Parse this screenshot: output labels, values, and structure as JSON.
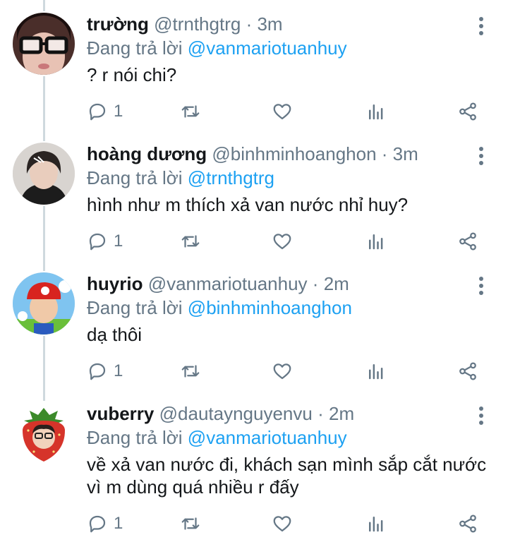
{
  "colors": {
    "accent": "#1da1f2",
    "muted": "#657786",
    "thread_line": "#cfd9de"
  },
  "tweets": [
    {
      "name": "trường",
      "handle": "@trnthgtrg",
      "time": "3m",
      "replying_prefix": "Đang trả lời",
      "replying_to": "@vanmariotuanhuy",
      "text": "? r nói chi?",
      "reply_count": "1",
      "avatar": "avatar-glasses"
    },
    {
      "name": "hoàng dương",
      "handle": "@binhminhoanghon",
      "time": "3m",
      "replying_prefix": "Đang trả lời",
      "replying_to": "@trnthgtrg",
      "text": "hình như m thích xả van nước nhỉ huy?",
      "reply_count": "1",
      "avatar": "avatar-hoodie"
    },
    {
      "name": "huyrio",
      "handle": "@vanmariotuanhuy",
      "time": "2m",
      "replying_prefix": "Đang trả lời",
      "replying_to": "@binhminhoanghon",
      "text": "dạ thôi",
      "reply_count": "1",
      "avatar": "avatar-mario"
    },
    {
      "name": "vuberry",
      "handle": "@dautaynguyenvu",
      "time": "2m",
      "replying_prefix": "Đang trả lời",
      "replying_to": "@vanmariotuanhuy",
      "text_line1": "về xả van nước đi, khách sạn mình sắp cắt nước",
      "text_line2": "vì m dùng quá nhiều r đấy",
      "reply_count": "1",
      "avatar": "avatar-strawberry"
    }
  ],
  "separator": "·"
}
